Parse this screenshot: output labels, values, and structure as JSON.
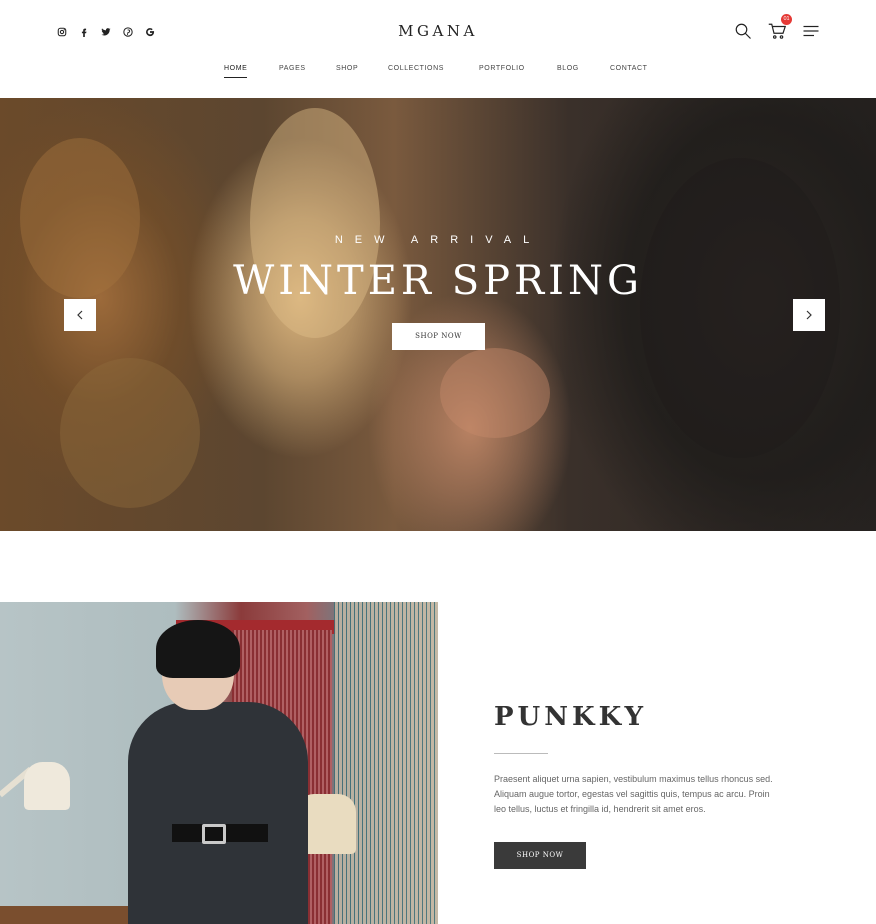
{
  "header": {
    "logo": "MGANA",
    "social": [
      {
        "name": "instagram",
        "icon": "instagram-icon"
      },
      {
        "name": "facebook",
        "icon": "facebook-icon"
      },
      {
        "name": "twitter",
        "icon": "twitter-icon"
      },
      {
        "name": "pinterest",
        "icon": "pinterest-icon"
      },
      {
        "name": "google",
        "icon": "google-icon"
      }
    ],
    "cart_count": "01",
    "nav": [
      "HOME",
      "PAGES",
      "SHOP",
      "COLLECTIONS",
      "PORTFOLIO",
      "BLOG",
      "CONTACT"
    ],
    "active_nav": "HOME"
  },
  "hero": {
    "subtitle": "NEW ARRIVAL",
    "title": "WINTER SPRING",
    "button": "SHOP NOW"
  },
  "feature": {
    "title": "PUNKKY",
    "text": "Praesent aliquet urna sapien, vestibulum maximus tellus rhoncus sed. Aliquam augue tortor, egestas vel sagittis quis, tempus ac arcu. Proin leo tellus, luctus et fringilla id, hendrerit sit amet eros.",
    "button": "SHOP NOW"
  },
  "colors": {
    "accent": "#e53935",
    "dark_button": "#3a3a3a",
    "text": "#222222"
  }
}
